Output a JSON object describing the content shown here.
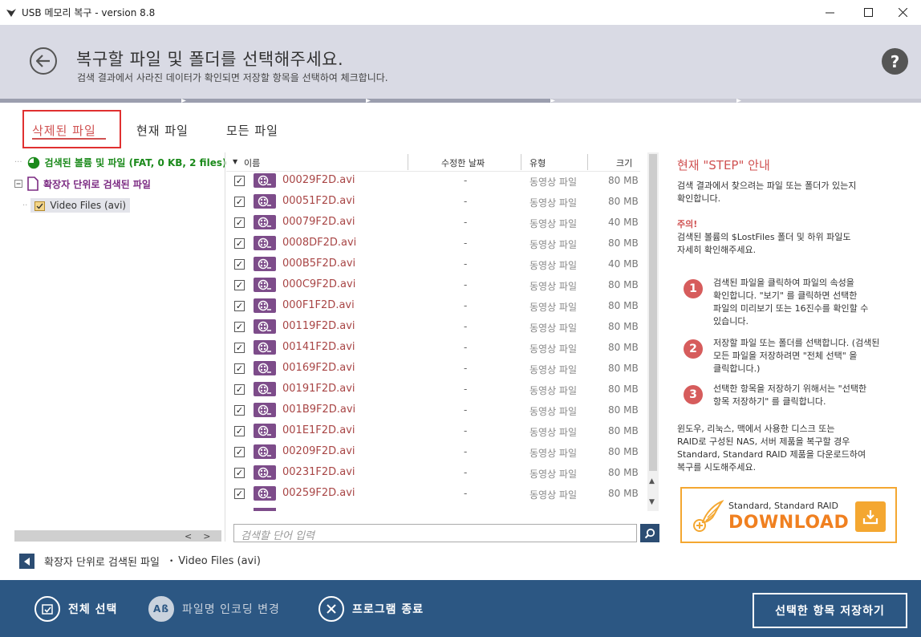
{
  "window": {
    "title": "USB 메모리 복구 - version 8.8"
  },
  "header": {
    "title": "복구할 파일 및 폴더를 선택해주세요.",
    "subtitle": "검색 결과에서 사라진 데이터가 확인되면 저장할 항목을 선택하여 체크합니다.",
    "help": "?"
  },
  "tabs": [
    {
      "label": "삭제된 파일",
      "active": true
    },
    {
      "label": "현재 파일",
      "active": false
    },
    {
      "label": "모든 파일",
      "active": false
    }
  ],
  "tree": {
    "volumes": "검색된 볼륨 및 파일 (FAT, 0 KB, 2 files)",
    "by_extension": "확장자 단위로 검색된 파일",
    "video": "Video Files (avi)"
  },
  "list": {
    "columns": {
      "name": "이름",
      "modified": "수정한 날짜",
      "type": "유형",
      "size": "크기"
    },
    "rows": [
      {
        "name": "00029F2D.avi",
        "date": "-",
        "type": "동영상 파일",
        "size": "80 MB"
      },
      {
        "name": "00051F2D.avi",
        "date": "-",
        "type": "동영상 파일",
        "size": "80 MB"
      },
      {
        "name": "00079F2D.avi",
        "date": "-",
        "type": "동영상 파일",
        "size": "40 MB"
      },
      {
        "name": "0008DF2D.avi",
        "date": "-",
        "type": "동영상 파일",
        "size": "80 MB"
      },
      {
        "name": "000B5F2D.avi",
        "date": "-",
        "type": "동영상 파일",
        "size": "40 MB"
      },
      {
        "name": "000C9F2D.avi",
        "date": "-",
        "type": "동영상 파일",
        "size": "80 MB"
      },
      {
        "name": "000F1F2D.avi",
        "date": "-",
        "type": "동영상 파일",
        "size": "80 MB"
      },
      {
        "name": "00119F2D.avi",
        "date": "-",
        "type": "동영상 파일",
        "size": "80 MB"
      },
      {
        "name": "00141F2D.avi",
        "date": "-",
        "type": "동영상 파일",
        "size": "80 MB"
      },
      {
        "name": "00169F2D.avi",
        "date": "-",
        "type": "동영상 파일",
        "size": "80 MB"
      },
      {
        "name": "00191F2D.avi",
        "date": "-",
        "type": "동영상 파일",
        "size": "80 MB"
      },
      {
        "name": "001B9F2D.avi",
        "date": "-",
        "type": "동영상 파일",
        "size": "80 MB"
      },
      {
        "name": "001E1F2D.avi",
        "date": "-",
        "type": "동영상 파일",
        "size": "80 MB"
      },
      {
        "name": "00209F2D.avi",
        "date": "-",
        "type": "동영상 파일",
        "size": "80 MB"
      },
      {
        "name": "00231F2D.avi",
        "date": "-",
        "type": "동영상 파일",
        "size": "80 MB"
      },
      {
        "name": "00259F2D.avi",
        "date": "-",
        "type": "동영상 파일",
        "size": "80 MB"
      }
    ]
  },
  "search": {
    "placeholder": "검색할 단어 입력"
  },
  "guide": {
    "title": "현재 \"STEP\" 안내",
    "intro_1": "검색 결과에서 찾으려는 파일 또는 폴더가 있는지",
    "intro_2": "확인합니다.",
    "note_title": "주의!",
    "note_1": "검색된 볼륨의 $LostFiles 폴더 및 하위 파일도",
    "note_2": "자세히 확인해주세요.",
    "step1_num": "1",
    "step1_1": "검색된 파일을 클릭하여 파일의 속성을",
    "step1_2": "확인합니다. \"보기\" 를 클릭하면 선택한",
    "step1_3": "파일의 미리보기 또는 16진수를 확인할 수",
    "step1_4": "있습니다.",
    "step2_num": "2",
    "step2_1": "저장할 파일 또는 폴더를 선택합니다. (검색된",
    "step2_2": "모든 파일을 저장하려면 \"전체 선택\" 을",
    "step2_3": "클릭합니다.)",
    "step3_num": "3",
    "step3_1": "선택한 항목을 저장하기 위해서는 \"선택한",
    "step3_2": "항목 저장하기\" 를 클릭합니다.",
    "outro_1": "윈도우, 리눅스, 맥에서 사용한 디스크 또는",
    "outro_2": "RAID로 구성된 NAS, 서버 제품을 복구할 경우",
    "outro_3": "Standard, Standard RAID 제품을 다운로드하여",
    "outro_4": "복구를 시도해주세요."
  },
  "download": {
    "product": "Standard, Standard RAID",
    "label": "DOWNLOAD"
  },
  "breadcrumb": {
    "part1": "확장자 단위로 검색된 파일",
    "part2": "Video Files (avi)"
  },
  "footer": {
    "select_all": "전체 선택",
    "encoding_icon": "Aß",
    "encoding": "파일명 인코딩 변경",
    "exit": "프로그램 종료",
    "save": "선택한 항목 저장하기"
  },
  "colors": {
    "accent": "#d05252",
    "footer": "#2c5783",
    "header": "#d9dae4",
    "download": "#f4a731"
  }
}
